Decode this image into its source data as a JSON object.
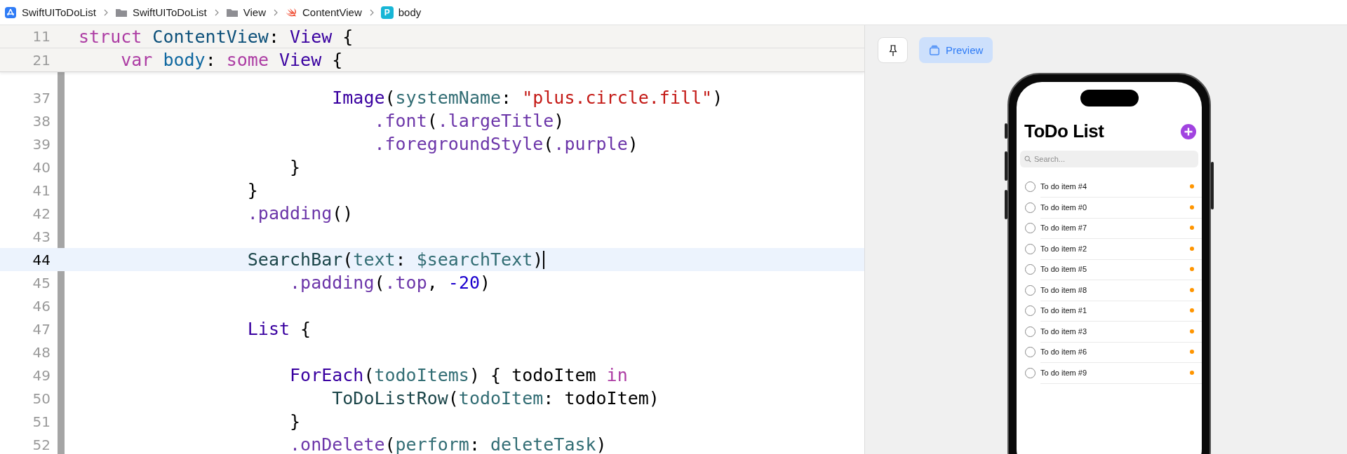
{
  "breadcrumb": [
    {
      "label": "SwiftUIToDoList",
      "kind": "app"
    },
    {
      "label": "SwiftUIToDoList",
      "kind": "folder"
    },
    {
      "label": "View",
      "kind": "folder"
    },
    {
      "label": "ContentView",
      "kind": "swift"
    },
    {
      "label": "body",
      "kind": "property",
      "badge": "P"
    }
  ],
  "sticky_lines": [
    {
      "number": "11",
      "tokens": [
        {
          "text": "struct ",
          "kind": "keyword"
        },
        {
          "text": "ContentView",
          "kind": "decl"
        },
        {
          "text": ": ",
          "kind": "plain"
        },
        {
          "text": "View",
          "kind": "type"
        },
        {
          "text": " {",
          "kind": "plain"
        }
      ]
    },
    {
      "number": "21",
      "tokens": [
        {
          "text": "    var ",
          "kind": "keyword"
        },
        {
          "text": "body",
          "kind": "decl2"
        },
        {
          "text": ": ",
          "kind": "plain"
        },
        {
          "text": "some ",
          "kind": "keyword"
        },
        {
          "text": "View",
          "kind": "type"
        },
        {
          "text": " {",
          "kind": "plain"
        }
      ]
    }
  ],
  "lines": [
    {
      "number": "37",
      "highlighted": false,
      "cursor": false,
      "tokens": [
        {
          "text": "                        Image",
          "kind": "type"
        },
        {
          "text": "(",
          "kind": "plain"
        },
        {
          "text": "systemName",
          "kind": "param"
        },
        {
          "text": ": ",
          "kind": "plain"
        },
        {
          "text": "\"plus.circle.fill\"",
          "kind": "string"
        },
        {
          "text": ")",
          "kind": "plain"
        }
      ]
    },
    {
      "number": "38",
      "highlighted": false,
      "cursor": false,
      "tokens": [
        {
          "text": "                            .font",
          "kind": "method"
        },
        {
          "text": "(",
          "kind": "plain"
        },
        {
          "text": ".largeTitle",
          "kind": "method"
        },
        {
          "text": ")",
          "kind": "plain"
        }
      ]
    },
    {
      "number": "39",
      "highlighted": false,
      "cursor": false,
      "tokens": [
        {
          "text": "                            .foregroundStyle",
          "kind": "method"
        },
        {
          "text": "(",
          "kind": "plain"
        },
        {
          "text": ".purple",
          "kind": "method"
        },
        {
          "text": ")",
          "kind": "plain"
        }
      ]
    },
    {
      "number": "40",
      "highlighted": false,
      "cursor": false,
      "tokens": [
        {
          "text": "                    }",
          "kind": "plain"
        }
      ]
    },
    {
      "number": "41",
      "highlighted": false,
      "cursor": false,
      "tokens": [
        {
          "text": "                }",
          "kind": "plain"
        }
      ]
    },
    {
      "number": "42",
      "highlighted": false,
      "cursor": false,
      "tokens": [
        {
          "text": "                .padding",
          "kind": "method"
        },
        {
          "text": "()",
          "kind": "plain"
        }
      ]
    },
    {
      "number": "43",
      "highlighted": false,
      "cursor": false
    },
    {
      "number": "44",
      "highlighted": true,
      "cursor": true,
      "tokens": [
        {
          "text": "                SearchBar",
          "kind": "decl3"
        },
        {
          "text": "(",
          "kind": "plain"
        },
        {
          "text": "text",
          "kind": "param"
        },
        {
          "text": ": ",
          "kind": "plain"
        },
        {
          "text": "$searchText",
          "kind": "param"
        },
        {
          "text": ")",
          "kind": "plain"
        }
      ]
    },
    {
      "number": "45",
      "highlighted": false,
      "cursor": false,
      "tokens": [
        {
          "text": "                    .padding",
          "kind": "method"
        },
        {
          "text": "(",
          "kind": "plain"
        },
        {
          "text": ".top",
          "kind": "method"
        },
        {
          "text": ", ",
          "kind": "plain"
        },
        {
          "text": "-20",
          "kind": "number"
        },
        {
          "text": ")",
          "kind": "plain"
        }
      ]
    },
    {
      "number": "46",
      "highlighted": false,
      "cursor": false
    },
    {
      "number": "47",
      "highlighted": false,
      "cursor": false,
      "tokens": [
        {
          "text": "                List",
          "kind": "type"
        },
        {
          "text": " {",
          "kind": "plain"
        }
      ]
    },
    {
      "number": "48",
      "highlighted": false,
      "cursor": false
    },
    {
      "number": "49",
      "highlighted": false,
      "cursor": false,
      "tokens": [
        {
          "text": "                    ForEach",
          "kind": "type"
        },
        {
          "text": "(",
          "kind": "plain"
        },
        {
          "text": "todoItems",
          "kind": "param"
        },
        {
          "text": ") { todoItem ",
          "kind": "plain"
        },
        {
          "text": "in",
          "kind": "keyword"
        }
      ]
    },
    {
      "number": "50",
      "highlighted": false,
      "cursor": false,
      "tokens": [
        {
          "text": "                        ToDoListRow",
          "kind": "decl3"
        },
        {
          "text": "(",
          "kind": "plain"
        },
        {
          "text": "todoItem",
          "kind": "param"
        },
        {
          "text": ": todoItem)",
          "kind": "plain"
        }
      ]
    },
    {
      "number": "51",
      "highlighted": false,
      "cursor": false,
      "tokens": [
        {
          "text": "                    }",
          "kind": "plain"
        }
      ]
    },
    {
      "number": "52",
      "highlighted": false,
      "cursor": false,
      "tokens": [
        {
          "text": "                    .onDelete",
          "kind": "method"
        },
        {
          "text": "(",
          "kind": "plain"
        },
        {
          "text": "perform",
          "kind": "param"
        },
        {
          "text": ": ",
          "kind": "plain"
        },
        {
          "text": "deleteTask",
          "kind": "param"
        },
        {
          "text": ")",
          "kind": "plain"
        }
      ]
    }
  ],
  "preview_toolbar": {
    "pin_selected": false,
    "preview": {
      "label": "Preview",
      "selected": true
    }
  },
  "app": {
    "title": "ToDo List",
    "search": {
      "placeholder": "Search..."
    },
    "rows": [
      {
        "label": "To do item #4",
        "done": false
      },
      {
        "label": "To do item #0",
        "done": false
      },
      {
        "label": "To do item #7",
        "done": false
      },
      {
        "label": "To do item #2",
        "done": false
      },
      {
        "label": "To do item #5",
        "done": false
      },
      {
        "label": "To do item #8",
        "done": false
      },
      {
        "label": "To do item #1",
        "done": false
      },
      {
        "label": "To do item #3",
        "done": false
      },
      {
        "label": "To do item #6",
        "done": false
      },
      {
        "label": "To do item #9",
        "done": false
      }
    ]
  }
}
